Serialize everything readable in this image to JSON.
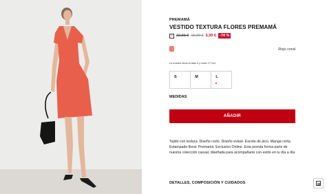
{
  "product": {
    "brand": "PREMAMÁ",
    "title": "VESTIDO TEXTURA FLORES PREMAMÁ",
    "price_original": "22,99 €",
    "price_previous": "15,99 €",
    "price_current": "5,99 €",
    "discount": "-74 %",
    "color_name": "Rojo coral",
    "model_note": "La modelo lleva la talla S y mide 177cm.",
    "sizes": [
      {
        "label": "S",
        "low_stock": false
      },
      {
        "label": "M",
        "low_stock": false
      },
      {
        "label": "L",
        "low_stock": true
      }
    ],
    "measures_label": "MEDIDAS",
    "add_button": "AÑADIR",
    "description": "Tejido con textura. Diseño corto. Diseño evasé. Escote de pico. Manga corta. Estampado floral. Premamá. Exclusivo Online. Esta prenda forma parte de nuestra colección casual, diseñada para acompañarte con estilo en tu día a día",
    "details_label": "DETALLES, COMPOSICIÓN Y CUIDADOS"
  },
  "icons": {
    "price_info": "info-icon",
    "swatch": "color-swatch",
    "floating": "list-icon"
  },
  "colors": {
    "accent": "#c00012",
    "sale": "#c8102e",
    "dress": "#e8604c"
  }
}
